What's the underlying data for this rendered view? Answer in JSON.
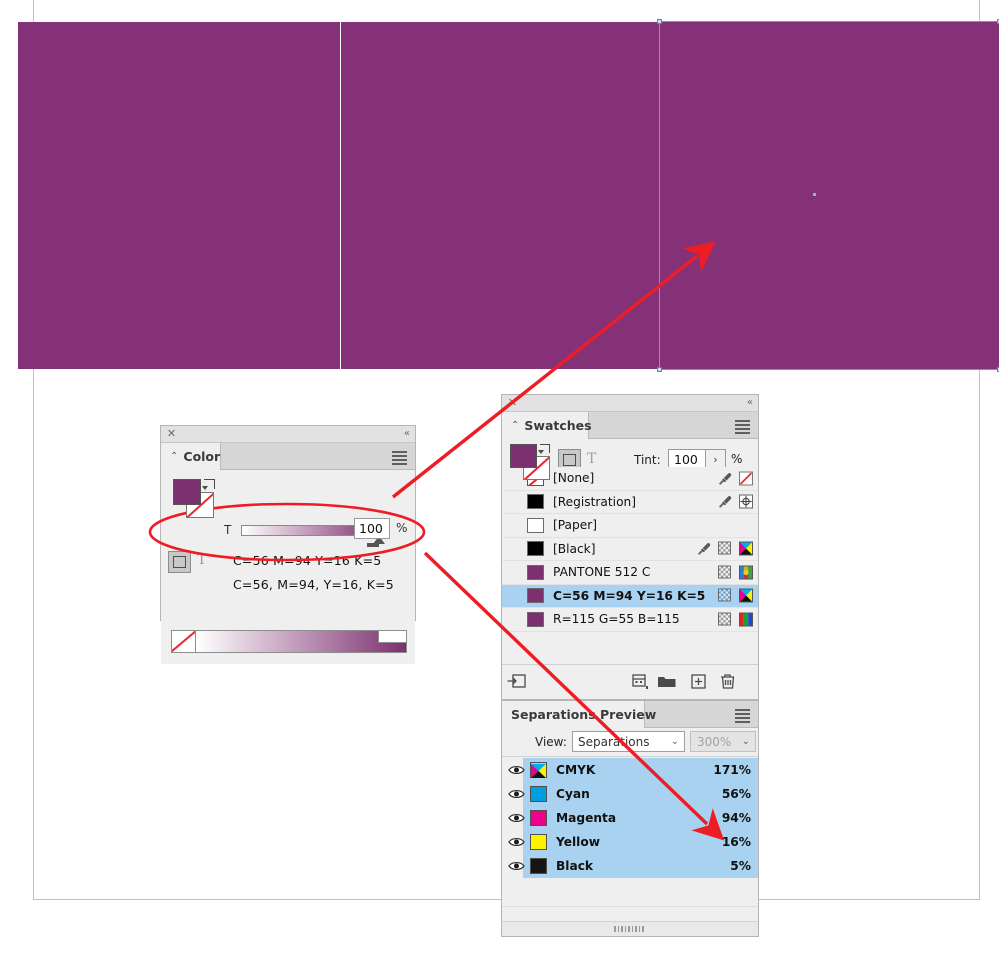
{
  "document": {
    "artwork_fill_color": "#853178",
    "selection_color": "#4ea6e8",
    "margin_guide_color": "#f09cf8",
    "pages": [
      "page-left",
      "page-middle",
      "page-right-selected"
    ]
  },
  "color_panel": {
    "close_label": "✕",
    "collapse_label": "«",
    "tab_caret": "⌃",
    "title": "Color",
    "menu_label": "panel-menu",
    "tint_letter": "T",
    "tint_value": "100",
    "percent_symbol": "%",
    "fill_swatch_color": "#7d3070",
    "mode_t_label": "T",
    "color_value_line1": "C=56 M=94 Y=16 K=5",
    "color_value_line2": "C=56, M=94, Y=16, K=5"
  },
  "swatches_panel": {
    "close_label": "✕",
    "collapse_label": "«",
    "tab_caret": "⌃",
    "title": "Swatches",
    "fill_swatch_color": "#7d3070",
    "mode_t_label": "T",
    "tint_label": "Tint:",
    "tint_value": "100",
    "tint_stepper_label": "›",
    "percent_symbol": "%",
    "rows": [
      {
        "name": "[None]",
        "chip": "none",
        "color": "#ffffff",
        "selected": false,
        "icons": [
          "eyedropper-icon",
          "none-slash-icon"
        ]
      },
      {
        "name": "[Registration]",
        "chip": "solid",
        "color": "#000000",
        "selected": false,
        "icons": [
          "eyedropper-icon",
          "registration-target-icon"
        ]
      },
      {
        "name": "[Paper]",
        "chip": "solid",
        "color": "#ffffff",
        "selected": false,
        "icons": []
      },
      {
        "name": "[Black]",
        "chip": "solid",
        "color": "#000000",
        "selected": false,
        "icons": [
          "eyedropper-icon",
          "tint-checker-icon",
          "cmyk-process-icon"
        ]
      },
      {
        "name": "PANTONE 512 C",
        "chip": "solid",
        "color": "#7d3070",
        "selected": false,
        "icons": [
          "tint-checker-icon",
          "spot-color-icon"
        ]
      },
      {
        "name": "C=56 M=94 Y=16 K=5",
        "chip": "solid",
        "color": "#7d3070",
        "selected": true,
        "icons": [
          "tint-checker-icon",
          "cmyk-process-icon"
        ]
      },
      {
        "name": "R=115 G=55 B=115",
        "chip": "solid",
        "color": "#7d3070",
        "selected": false,
        "icons": [
          "tint-checker-icon",
          "rgb-process-icon"
        ]
      }
    ],
    "footer_buttons": [
      "show-all-swatches-icon",
      "new-color-group-icon",
      "new-swatch-folder-icon",
      "new-swatch-icon",
      "delete-swatch-icon"
    ]
  },
  "separations_panel": {
    "title": "Separations Preview",
    "view_label": "View:",
    "view_value": "Separations",
    "zoom_value": "300%",
    "select_caret": "⌄",
    "rows": [
      {
        "name": "CMYK",
        "value": "171%",
        "chip": "cmyk",
        "color": "#00a0e0",
        "visible": true,
        "selected": true
      },
      {
        "name": "Cyan",
        "value": "56%",
        "chip": "solid",
        "color": "#00a0e0",
        "visible": true,
        "selected": true
      },
      {
        "name": "Magenta",
        "value": "94%",
        "chip": "solid",
        "color": "#ec008c",
        "visible": true,
        "selected": true
      },
      {
        "name": "Yellow",
        "value": "16%",
        "chip": "solid",
        "color": "#fff200",
        "visible": true,
        "selected": true
      },
      {
        "name": "Black",
        "value": "5%",
        "chip": "solid",
        "color": "#151515",
        "visible": true,
        "selected": true
      }
    ]
  },
  "annotations": {
    "color": "#ee1c24",
    "ellipse_target": "color-panel-cmyk-values",
    "arrow_1": "swatches-tint-to-artwork",
    "arrow_2": "color-values-to-magenta-separation"
  }
}
